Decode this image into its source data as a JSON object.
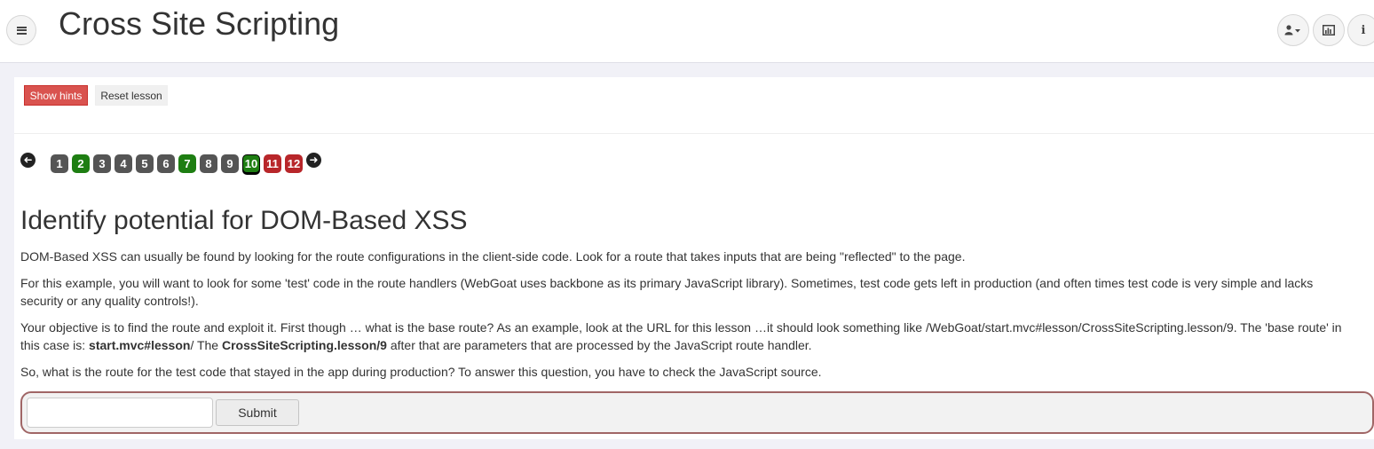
{
  "header": {
    "title": "Cross Site Scripting",
    "menu_icon": "hamburger-menu-icon",
    "user_icon": "user-dropdown-icon",
    "chart_icon": "bar-chart-icon",
    "info_icon": "info-icon"
  },
  "toolbar": {
    "show_hints_label": "Show hints",
    "reset_lesson_label": "Reset lesson"
  },
  "pagination": {
    "prev_icon": "arrow-left-icon",
    "next_icon": "arrow-right-icon",
    "pages": [
      {
        "label": "1",
        "status": "grey"
      },
      {
        "label": "2",
        "status": "green"
      },
      {
        "label": "3",
        "status": "grey"
      },
      {
        "label": "4",
        "status": "grey"
      },
      {
        "label": "5",
        "status": "grey"
      },
      {
        "label": "6",
        "status": "grey"
      },
      {
        "label": "7",
        "status": "green"
      },
      {
        "label": "8",
        "status": "grey"
      },
      {
        "label": "9",
        "status": "grey"
      },
      {
        "label": "10",
        "status": "green",
        "current": true
      },
      {
        "label": "11",
        "status": "red"
      },
      {
        "label": "12",
        "status": "red"
      }
    ]
  },
  "lesson": {
    "title": "Identify potential for DOM-Based XSS",
    "p1": "DOM-Based XSS can usually be found by looking for the route configurations in the client-side code. Look for a route that takes inputs that are being \"reflected\" to the page.",
    "p2": "For this example, you will want to look for some 'test' code in the route handlers (WebGoat uses backbone as its primary JavaScript library). Sometimes, test code gets left in production (and often times test code is very simple and lacks security or any quality controls!).",
    "p3_a": "Your objective is to find the route and exploit it. First though … what is the base route? As an example, look at the URL for this lesson …it should look something like /WebGoat/start.mvc#lesson/CrossSiteScripting.lesson/9. The 'base route' in this case is: ",
    "p3_b": "start.mvc#lesson",
    "p3_c": "/ The ",
    "p3_d": "CrossSiteScripting.lesson",
    "p3_e": "/",
    "p3_f": "9",
    "p3_g": " after that are parameters that are processed by the JavaScript route handler.",
    "p4": "So, what is the route for the test code that stayed in the app during production? To answer this question, you have to check the JavaScript source."
  },
  "form": {
    "answer_value": "",
    "submit_label": "Submit"
  },
  "colors": {
    "grey": "#555555",
    "green": "#1e7e12",
    "red": "#b8262a",
    "hints_button": "#d9534f",
    "form_border": "#a06666"
  }
}
